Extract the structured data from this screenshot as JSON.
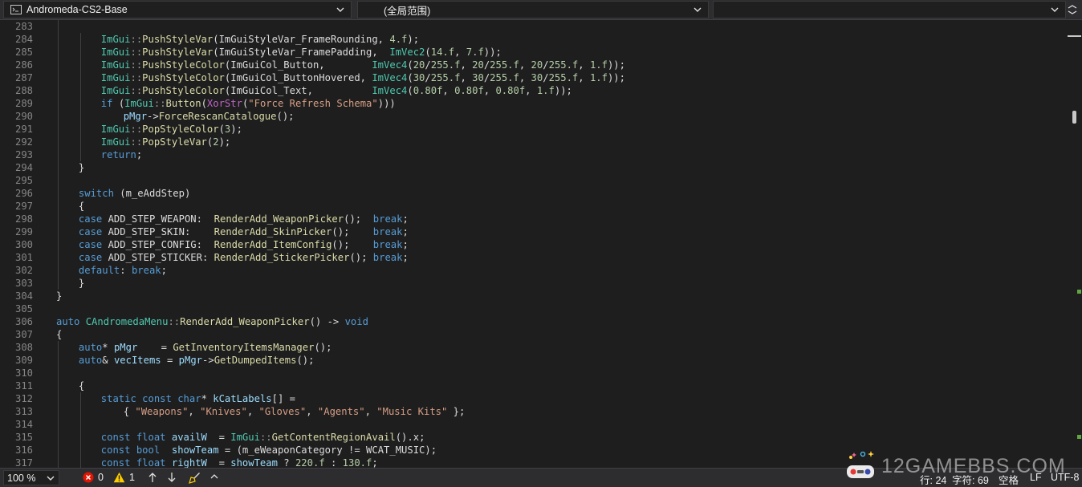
{
  "navbar": {
    "project": "Andromeda-CS2-Base",
    "scope": "(全局范围)",
    "member": ""
  },
  "editor": {
    "lines": [
      {
        "num": "283",
        "indent": 0,
        "tokens": []
      },
      {
        "num": "284",
        "indent": 2,
        "tokens": [
          {
            "t": "ImGui",
            "c": "ty"
          },
          {
            "t": "::",
            "c": "nsp"
          },
          {
            "t": "PushStyleVar",
            "c": "fn"
          },
          {
            "t": "(ImGuiStyleVar_FrameRounding, ",
            "c": ""
          },
          {
            "t": "4.f",
            "c": "nm"
          },
          {
            "t": ");",
            "c": ""
          }
        ]
      },
      {
        "num": "285",
        "indent": 2,
        "tokens": [
          {
            "t": "ImGui",
            "c": "ty"
          },
          {
            "t": "::",
            "c": "nsp"
          },
          {
            "t": "PushStyleVar",
            "c": "fn"
          },
          {
            "t": "(ImGuiStyleVar_FramePadding,  ",
            "c": ""
          },
          {
            "t": "ImVec2",
            "c": "ty"
          },
          {
            "t": "(",
            "c": ""
          },
          {
            "t": "14.f",
            "c": "nm"
          },
          {
            "t": ", ",
            "c": ""
          },
          {
            "t": "7.f",
            "c": "nm"
          },
          {
            "t": "));",
            "c": ""
          }
        ]
      },
      {
        "num": "286",
        "indent": 2,
        "tokens": [
          {
            "t": "ImGui",
            "c": "ty"
          },
          {
            "t": "::",
            "c": "nsp"
          },
          {
            "t": "PushStyleColor",
            "c": "fn"
          },
          {
            "t": "(ImGuiCol_Button,        ",
            "c": ""
          },
          {
            "t": "ImVec4",
            "c": "ty"
          },
          {
            "t": "(",
            "c": ""
          },
          {
            "t": "20",
            "c": "nm"
          },
          {
            "t": "/",
            "c": ""
          },
          {
            "t": "255.f",
            "c": "nm"
          },
          {
            "t": ", ",
            "c": ""
          },
          {
            "t": "20",
            "c": "nm"
          },
          {
            "t": "/",
            "c": ""
          },
          {
            "t": "255.f",
            "c": "nm"
          },
          {
            "t": ", ",
            "c": ""
          },
          {
            "t": "20",
            "c": "nm"
          },
          {
            "t": "/",
            "c": ""
          },
          {
            "t": "255.f",
            "c": "nm"
          },
          {
            "t": ", ",
            "c": ""
          },
          {
            "t": "1.f",
            "c": "nm"
          },
          {
            "t": "));",
            "c": ""
          }
        ]
      },
      {
        "num": "287",
        "indent": 2,
        "tokens": [
          {
            "t": "ImGui",
            "c": "ty"
          },
          {
            "t": "::",
            "c": "nsp"
          },
          {
            "t": "PushStyleColor",
            "c": "fn"
          },
          {
            "t": "(ImGuiCol_ButtonHovered, ",
            "c": ""
          },
          {
            "t": "ImVec4",
            "c": "ty"
          },
          {
            "t": "(",
            "c": ""
          },
          {
            "t": "30",
            "c": "nm"
          },
          {
            "t": "/",
            "c": ""
          },
          {
            "t": "255.f",
            "c": "nm"
          },
          {
            "t": ", ",
            "c": ""
          },
          {
            "t": "30",
            "c": "nm"
          },
          {
            "t": "/",
            "c": ""
          },
          {
            "t": "255.f",
            "c": "nm"
          },
          {
            "t": ", ",
            "c": ""
          },
          {
            "t": "30",
            "c": "nm"
          },
          {
            "t": "/",
            "c": ""
          },
          {
            "t": "255.f",
            "c": "nm"
          },
          {
            "t": ", ",
            "c": ""
          },
          {
            "t": "1.f",
            "c": "nm"
          },
          {
            "t": "));",
            "c": ""
          }
        ]
      },
      {
        "num": "288",
        "indent": 2,
        "tokens": [
          {
            "t": "ImGui",
            "c": "ty"
          },
          {
            "t": "::",
            "c": "nsp"
          },
          {
            "t": "PushStyleColor",
            "c": "fn"
          },
          {
            "t": "(ImGuiCol_Text,          ",
            "c": ""
          },
          {
            "t": "ImVec4",
            "c": "ty"
          },
          {
            "t": "(",
            "c": ""
          },
          {
            "t": "0.80f",
            "c": "nm"
          },
          {
            "t": ", ",
            "c": ""
          },
          {
            "t": "0.80f",
            "c": "nm"
          },
          {
            "t": ", ",
            "c": ""
          },
          {
            "t": "0.80f",
            "c": "nm"
          },
          {
            "t": ", ",
            "c": ""
          },
          {
            "t": "1.f",
            "c": "nm"
          },
          {
            "t": "));",
            "c": ""
          }
        ]
      },
      {
        "num": "289",
        "indent": 2,
        "tokens": [
          {
            "t": "if",
            "c": "kw"
          },
          {
            "t": " (",
            "c": ""
          },
          {
            "t": "ImGui",
            "c": "ty"
          },
          {
            "t": "::",
            "c": "nsp"
          },
          {
            "t": "Button",
            "c": "fn"
          },
          {
            "t": "(",
            "c": ""
          },
          {
            "t": "XorStr",
            "c": "mc"
          },
          {
            "t": "(",
            "c": ""
          },
          {
            "t": "\"Force Refresh Schema\"",
            "c": "st"
          },
          {
            "t": ")))",
            "c": ""
          }
        ]
      },
      {
        "num": "290",
        "indent": 3,
        "tokens": [
          {
            "t": "pMgr",
            "c": "vr"
          },
          {
            "t": "->",
            "c": ""
          },
          {
            "t": "ForceRescanCatalogue",
            "c": "fn"
          },
          {
            "t": "();",
            "c": ""
          }
        ]
      },
      {
        "num": "291",
        "indent": 2,
        "tokens": [
          {
            "t": "ImGui",
            "c": "ty"
          },
          {
            "t": "::",
            "c": "nsp"
          },
          {
            "t": "PopStyleColor",
            "c": "fn"
          },
          {
            "t": "(",
            "c": ""
          },
          {
            "t": "3",
            "c": "nm"
          },
          {
            "t": ");",
            "c": ""
          }
        ]
      },
      {
        "num": "292",
        "indent": 2,
        "tokens": [
          {
            "t": "ImGui",
            "c": "ty"
          },
          {
            "t": "::",
            "c": "nsp"
          },
          {
            "t": "PopStyleVar",
            "c": "fn"
          },
          {
            "t": "(",
            "c": ""
          },
          {
            "t": "2",
            "c": "nm"
          },
          {
            "t": ");",
            "c": ""
          }
        ]
      },
      {
        "num": "293",
        "indent": 2,
        "tokens": [
          {
            "t": "return",
            "c": "kw"
          },
          {
            "t": ";",
            "c": ""
          }
        ]
      },
      {
        "num": "294",
        "indent": 1,
        "tokens": [
          {
            "t": "}",
            "c": ""
          }
        ]
      },
      {
        "num": "295",
        "indent": 0,
        "tokens": []
      },
      {
        "num": "296",
        "indent": 1,
        "tokens": [
          {
            "t": "switch",
            "c": "kw"
          },
          {
            "t": " (m_eAddStep)",
            "c": ""
          }
        ]
      },
      {
        "num": "297",
        "indent": 1,
        "tokens": [
          {
            "t": "{",
            "c": ""
          }
        ]
      },
      {
        "num": "298",
        "indent": 1,
        "tokens": [
          {
            "t": "case",
            "c": "kw"
          },
          {
            "t": " ADD_STEP_WEAPON:  ",
            "c": ""
          },
          {
            "t": "RenderAdd_WeaponPicker",
            "c": "fn"
          },
          {
            "t": "();  ",
            "c": ""
          },
          {
            "t": "break",
            "c": "kw"
          },
          {
            "t": ";",
            "c": ""
          }
        ]
      },
      {
        "num": "299",
        "indent": 1,
        "tokens": [
          {
            "t": "case",
            "c": "kw"
          },
          {
            "t": " ADD_STEP_SKIN:    ",
            "c": ""
          },
          {
            "t": "RenderAdd_SkinPicker",
            "c": "fn"
          },
          {
            "t": "();    ",
            "c": ""
          },
          {
            "t": "break",
            "c": "kw"
          },
          {
            "t": ";",
            "c": ""
          }
        ]
      },
      {
        "num": "300",
        "indent": 1,
        "tokens": [
          {
            "t": "case",
            "c": "kw"
          },
          {
            "t": " ADD_STEP_CONFIG:  ",
            "c": ""
          },
          {
            "t": "RenderAdd_ItemConfig",
            "c": "fn"
          },
          {
            "t": "();    ",
            "c": ""
          },
          {
            "t": "break",
            "c": "kw"
          },
          {
            "t": ";",
            "c": ""
          }
        ]
      },
      {
        "num": "301",
        "indent": 1,
        "tokens": [
          {
            "t": "case",
            "c": "kw"
          },
          {
            "t": " ADD_STEP_STICKER: ",
            "c": ""
          },
          {
            "t": "RenderAdd_StickerPicker",
            "c": "fn"
          },
          {
            "t": "(); ",
            "c": ""
          },
          {
            "t": "break",
            "c": "kw"
          },
          {
            "t": ";",
            "c": ""
          }
        ]
      },
      {
        "num": "302",
        "indent": 1,
        "tokens": [
          {
            "t": "default",
            "c": "kw"
          },
          {
            "t": ": ",
            "c": ""
          },
          {
            "t": "break",
            "c": "kw"
          },
          {
            "t": ";",
            "c": ""
          }
        ]
      },
      {
        "num": "303",
        "indent": 1,
        "tokens": [
          {
            "t": "}",
            "c": ""
          }
        ]
      },
      {
        "num": "304",
        "indent": 0,
        "tokens": [
          {
            "t": "}",
            "c": ""
          }
        ]
      },
      {
        "num": "305",
        "indent": 0,
        "tokens": []
      },
      {
        "num": "306",
        "indent": 0,
        "tokens": [
          {
            "t": "auto",
            "c": "kw"
          },
          {
            "t": " ",
            "c": ""
          },
          {
            "t": "CAndromedaMenu",
            "c": "ty"
          },
          {
            "t": "::",
            "c": "nsp"
          },
          {
            "t": "RenderAdd_WeaponPicker",
            "c": "fn"
          },
          {
            "t": "() -> ",
            "c": ""
          },
          {
            "t": "void",
            "c": "kw"
          }
        ]
      },
      {
        "num": "307",
        "indent": 0,
        "tokens": [
          {
            "t": "{",
            "c": ""
          }
        ]
      },
      {
        "num": "308",
        "indent": 1,
        "tokens": [
          {
            "t": "auto",
            "c": "kw"
          },
          {
            "t": "* ",
            "c": ""
          },
          {
            "t": "pMgr",
            "c": "vr"
          },
          {
            "t": "    = ",
            "c": ""
          },
          {
            "t": "GetInventoryItemsManager",
            "c": "fn"
          },
          {
            "t": "();",
            "c": ""
          }
        ]
      },
      {
        "num": "309",
        "indent": 1,
        "tokens": [
          {
            "t": "auto",
            "c": "kw"
          },
          {
            "t": "& ",
            "c": ""
          },
          {
            "t": "vecItems",
            "c": "vr"
          },
          {
            "t": " = ",
            "c": ""
          },
          {
            "t": "pMgr",
            "c": "vr"
          },
          {
            "t": "->",
            "c": ""
          },
          {
            "t": "GetDumpedItems",
            "c": "fn"
          },
          {
            "t": "();",
            "c": ""
          }
        ]
      },
      {
        "num": "310",
        "indent": 0,
        "tokens": []
      },
      {
        "num": "311",
        "indent": 1,
        "tokens": [
          {
            "t": "{",
            "c": ""
          }
        ]
      },
      {
        "num": "312",
        "indent": 2,
        "tokens": [
          {
            "t": "static",
            "c": "kw"
          },
          {
            "t": " ",
            "c": ""
          },
          {
            "t": "const",
            "c": "kw"
          },
          {
            "t": " ",
            "c": ""
          },
          {
            "t": "char",
            "c": "kw"
          },
          {
            "t": "* ",
            "c": ""
          },
          {
            "t": "kCatLabels",
            "c": "vr"
          },
          {
            "t": "[] =",
            "c": ""
          }
        ]
      },
      {
        "num": "313",
        "indent": 3,
        "tokens": [
          {
            "t": "{ ",
            "c": ""
          },
          {
            "t": "\"Weapons\"",
            "c": "st"
          },
          {
            "t": ", ",
            "c": ""
          },
          {
            "t": "\"Knives\"",
            "c": "st"
          },
          {
            "t": ", ",
            "c": ""
          },
          {
            "t": "\"Gloves\"",
            "c": "st"
          },
          {
            "t": ", ",
            "c": ""
          },
          {
            "t": "\"Agents\"",
            "c": "st"
          },
          {
            "t": ", ",
            "c": ""
          },
          {
            "t": "\"Music Kits\"",
            "c": "st"
          },
          {
            "t": " };",
            "c": ""
          }
        ]
      },
      {
        "num": "314",
        "indent": 0,
        "tokens": []
      },
      {
        "num": "315",
        "indent": 2,
        "tokens": [
          {
            "t": "const",
            "c": "kw"
          },
          {
            "t": " ",
            "c": ""
          },
          {
            "t": "float",
            "c": "kw"
          },
          {
            "t": " ",
            "c": ""
          },
          {
            "t": "availW",
            "c": "vr"
          },
          {
            "t": "  = ",
            "c": ""
          },
          {
            "t": "ImGui",
            "c": "ty"
          },
          {
            "t": "::",
            "c": "nsp"
          },
          {
            "t": "GetContentRegionAvail",
            "c": "fn"
          },
          {
            "t": "().x;",
            "c": ""
          }
        ]
      },
      {
        "num": "316",
        "indent": 2,
        "tokens": [
          {
            "t": "const",
            "c": "kw"
          },
          {
            "t": " ",
            "c": ""
          },
          {
            "t": "bool",
            "c": "kw"
          },
          {
            "t": "  ",
            "c": ""
          },
          {
            "t": "showTeam",
            "c": "vr"
          },
          {
            "t": " = (m_eWeaponCategory != WCAT_MUSIC);",
            "c": ""
          }
        ]
      },
      {
        "num": "317",
        "indent": 2,
        "tokens": [
          {
            "t": "const",
            "c": "kw"
          },
          {
            "t": " ",
            "c": ""
          },
          {
            "t": "float",
            "c": "kw"
          },
          {
            "t": " ",
            "c": ""
          },
          {
            "t": "rightW",
            "c": "vr"
          },
          {
            "t": "  = ",
            "c": ""
          },
          {
            "t": "showTeam",
            "c": "vr"
          },
          {
            "t": " ? ",
            "c": ""
          },
          {
            "t": "220.f",
            "c": "nm"
          },
          {
            "t": " : ",
            "c": ""
          },
          {
            "t": "130.f",
            "c": "nm"
          },
          {
            "t": ";",
            "c": ""
          }
        ]
      }
    ]
  },
  "status": {
    "zoom": "100 %",
    "errors": "0",
    "warnings": "1",
    "position": "行: 24",
    "column": "字符: 69",
    "whitespace": "空格",
    "line_ending": "LF",
    "encoding": "UTF-8"
  },
  "watermark": {
    "text": "12GAMEBBS.COM"
  },
  "colors": {
    "background": "#1e1e1e",
    "keyword": "#569cd6",
    "type": "#4ec9b0",
    "function": "#dcdcaa",
    "string": "#d69d85",
    "number": "#b5cea8",
    "macro": "#bd63c5",
    "variable": "#9cdcfe",
    "error": "#e51400",
    "warning": "#ffcc00",
    "changed": "#5ea743"
  }
}
